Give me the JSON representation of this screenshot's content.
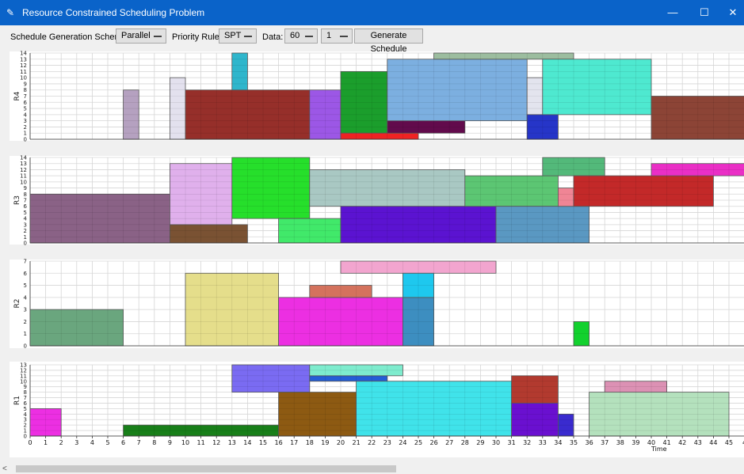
{
  "window": {
    "title": "Resource Constrained Scheduling Problem",
    "icon": "feather-icon",
    "minimize": "—",
    "maximize": "☐",
    "close": "✕"
  },
  "toolbar": {
    "sgs_label": "Schedule Generation Scheme:",
    "sgs_value": "Parallel",
    "priority_label": "Priority Rule:",
    "priority_value": "SPT",
    "data_label": "Data:",
    "data_value": "60",
    "instance_value": "1",
    "generate_label": "Generate Schedule"
  },
  "chart_data": {
    "type": "gantt",
    "xlabel": "Time",
    "x_ticks": [
      "0",
      "1",
      "2",
      "3",
      "4",
      "5",
      "6",
      "7",
      "8",
      "9",
      "10",
      "11",
      "12",
      "13",
      "14",
      "15",
      "16",
      "17",
      "18",
      "19",
      "20",
      "21",
      "22",
      "23",
      "24",
      "25",
      "26",
      "27",
      "28",
      "29",
      "30",
      "31",
      "32",
      "33",
      "34",
      "35",
      "36",
      "37",
      "38",
      "39",
      "40",
      "41",
      "42",
      "43",
      "44",
      "45",
      "4"
    ],
    "panels": [
      {
        "resource": "R4",
        "ylim": [
          0,
          14
        ],
        "bars": [
          {
            "x0": 6,
            "x1": 7,
            "y0": 0,
            "y1": 8,
            "color": "#b5a1c0"
          },
          {
            "x0": 9,
            "x1": 10,
            "y0": 0,
            "y1": 10,
            "color": "#e3e1ee"
          },
          {
            "x0": 10,
            "x1": 18,
            "y0": 0,
            "y1": 8,
            "color": "#962f2a"
          },
          {
            "x0": 13,
            "x1": 14,
            "y0": 8,
            "y1": 14,
            "color": "#2fb6cc"
          },
          {
            "x0": 18,
            "x1": 20,
            "y0": 0,
            "y1": 8,
            "color": "#9c57e6"
          },
          {
            "x0": 20,
            "x1": 23,
            "y0": 1,
            "y1": 11,
            "color": "#1b9e2c"
          },
          {
            "x0": 20,
            "x1": 25,
            "y0": 0,
            "y1": 1,
            "color": "#ef2323"
          },
          {
            "x0": 23,
            "x1": 28,
            "y0": 1,
            "y1": 3,
            "color": "#620b4c"
          },
          {
            "x0": 23,
            "x1": 32,
            "y0": 3,
            "y1": 13,
            "color": "#7cafe0"
          },
          {
            "x0": 26,
            "x1": 35,
            "y0": 13,
            "y1": 14,
            "color": "#9cbd9f"
          },
          {
            "x0": 32,
            "x1": 33,
            "y0": 4,
            "y1": 10,
            "color": "#e3e4ee"
          },
          {
            "x0": 32,
            "x1": 34,
            "y0": 0,
            "y1": 4,
            "color": "#2635c8"
          },
          {
            "x0": 33,
            "x1": 40,
            "y0": 4,
            "y1": 13,
            "color": "#4ee9d0"
          },
          {
            "x0": 40,
            "x1": 46,
            "y0": 0,
            "y1": 7,
            "color": "#8c4436"
          }
        ]
      },
      {
        "resource": "R3",
        "ylim": [
          0,
          14
        ],
        "bars": [
          {
            "x0": 0,
            "x1": 9,
            "y0": 0,
            "y1": 8,
            "color": "#8a6286"
          },
          {
            "x0": 9,
            "x1": 14,
            "y0": 0,
            "y1": 3,
            "color": "#7a5233"
          },
          {
            "x0": 9,
            "x1": 13,
            "y0": 3,
            "y1": 13,
            "color": "#e0b0ec"
          },
          {
            "x0": 13,
            "x1": 18,
            "y0": 4,
            "y1": 14,
            "color": "#26df2b"
          },
          {
            "x0": 16,
            "x1": 20,
            "y0": 0,
            "y1": 4,
            "color": "#41e96a"
          },
          {
            "x0": 18,
            "x1": 28,
            "y0": 6,
            "y1": 12,
            "color": "#a9c8c3"
          },
          {
            "x0": 20,
            "x1": 30,
            "y0": 0,
            "y1": 6,
            "color": "#5b13d1"
          },
          {
            "x0": 28,
            "x1": 34,
            "y0": 6,
            "y1": 11,
            "color": "#5cc673"
          },
          {
            "x0": 30,
            "x1": 36,
            "y0": 0,
            "y1": 6,
            "color": "#5a98c2"
          },
          {
            "x0": 33,
            "x1": 37,
            "y0": 11,
            "y1": 14,
            "color": "#53b97a"
          },
          {
            "x0": 34,
            "x1": 35,
            "y0": 6,
            "y1": 9,
            "color": "#f08595"
          },
          {
            "x0": 35,
            "x1": 44,
            "y0": 6,
            "y1": 11,
            "color": "#c32929"
          },
          {
            "x0": 40,
            "x1": 46,
            "y0": 11,
            "y1": 13,
            "color": "#ea2fc6"
          }
        ]
      },
      {
        "resource": "R2",
        "ylim": [
          0,
          7
        ],
        "bars": [
          {
            "x0": 0,
            "x1": 6,
            "y0": 0,
            "y1": 3,
            "color": "#6aa67e"
          },
          {
            "x0": 10,
            "x1": 16,
            "y0": 0,
            "y1": 6,
            "color": "#e5de8b"
          },
          {
            "x0": 16,
            "x1": 24,
            "y0": 0,
            "y1": 4,
            "color": "#ec2fe2"
          },
          {
            "x0": 18,
            "x1": 22,
            "y0": 4,
            "y1": 5,
            "color": "#d4725d"
          },
          {
            "x0": 20,
            "x1": 30,
            "y0": 6,
            "y1": 7,
            "color": "#f2a5cf"
          },
          {
            "x0": 24,
            "x1": 26,
            "y0": 0,
            "y1": 4,
            "color": "#3d8ec0"
          },
          {
            "x0": 24,
            "x1": 26,
            "y0": 4,
            "y1": 6,
            "color": "#1ec8ee"
          },
          {
            "x0": 35,
            "x1": 36,
            "y0": 0,
            "y1": 2,
            "color": "#12d12e"
          }
        ]
      },
      {
        "resource": "R1",
        "ylim": [
          0,
          13
        ],
        "bars": [
          {
            "x0": 0,
            "x1": 2,
            "y0": 0,
            "y1": 5,
            "color": "#ec2fe2"
          },
          {
            "x0": 6,
            "x1": 16,
            "y0": 0,
            "y1": 2,
            "color": "#187f19"
          },
          {
            "x0": 13,
            "x1": 18,
            "y0": 8,
            "y1": 13,
            "color": "#7a6bf2"
          },
          {
            "x0": 16,
            "x1": 21,
            "y0": 0,
            "y1": 8,
            "color": "#8d5a12"
          },
          {
            "x0": 18,
            "x1": 23,
            "y0": 10,
            "y1": 11,
            "color": "#245ed6"
          },
          {
            "x0": 18,
            "x1": 24,
            "y0": 11,
            "y1": 13,
            "color": "#7eecce"
          },
          {
            "x0": 21,
            "x1": 31,
            "y0": 0,
            "y1": 10,
            "color": "#40e3ea"
          },
          {
            "x0": 31,
            "x1": 34,
            "y0": 6,
            "y1": 11,
            "color": "#b23a2f"
          },
          {
            "x0": 31,
            "x1": 34,
            "y0": 0,
            "y1": 6,
            "color": "#6a10d0"
          },
          {
            "x0": 34,
            "x1": 35,
            "y0": 0,
            "y1": 4,
            "color": "#3a2bcf"
          },
          {
            "x0": 36,
            "x1": 45,
            "y0": 0,
            "y1": 8,
            "color": "#b4e1bd"
          },
          {
            "x0": 37,
            "x1": 41,
            "y0": 8,
            "y1": 10,
            "color": "#dc91b4"
          }
        ]
      }
    ]
  },
  "scrollbar": {
    "left_arrow": "<"
  }
}
